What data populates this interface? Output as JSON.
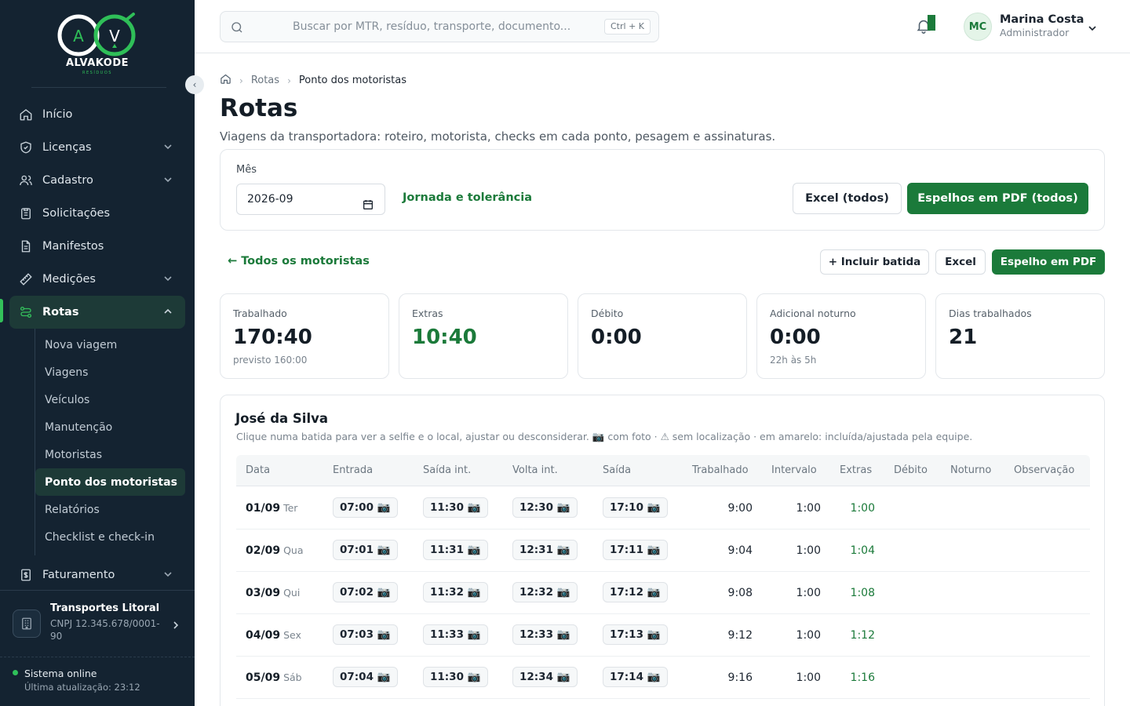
{
  "sidebar": {
    "brand": "ALVAKODE",
    "brand_sub": "RESÍDUOS",
    "collapse_icon": "‹",
    "nav": [
      {
        "label": "Início",
        "icon": "home-icon",
        "chevron": false
      },
      {
        "label": "Licenças",
        "icon": "shield-icon",
        "chevron": true
      },
      {
        "label": "Cadastro",
        "icon": "users-icon",
        "chevron": true
      },
      {
        "label": "Solicitações",
        "icon": "clipboard-icon",
        "chevron": false
      },
      {
        "label": "Manifestos",
        "icon": "document-icon",
        "chevron": false
      },
      {
        "label": "Medições",
        "icon": "ruler-icon",
        "chevron": true
      },
      {
        "label": "Rotas",
        "icon": "route-icon",
        "chevron": true,
        "active": true
      },
      {
        "label": "Faturamento",
        "icon": "invoice-icon",
        "chevron": true
      }
    ],
    "sub_nav": [
      "Nova viagem",
      "Viagens",
      "Veículos",
      "Manutenção",
      "Motoristas",
      "Ponto dos motoristas",
      "Relatórios",
      "Checklist e check-in"
    ],
    "company": {
      "name": "Transportes Litoral",
      "cnpj": "CNPJ 12.345.678/0001-90"
    },
    "status": {
      "title": "Sistema online",
      "updated": "Última atualização: 23:12"
    }
  },
  "topbar": {
    "search_placeholder": "Buscar por MTR, resíduo, transporte, documento...",
    "shortcut": "Ctrl + K",
    "user": {
      "initials": "MC",
      "name": "Marina Costa",
      "role": "Administrador"
    }
  },
  "breadcrumb": {
    "section": "Rotas",
    "current": "Ponto dos motoristas"
  },
  "page": {
    "title": "Rotas",
    "subtitle": "Viagens da transportadora: roteiro, motorista, checks em cada ponto, pesagem e assinaturas."
  },
  "filter": {
    "month_label": "Mês",
    "month_value": "2026-09",
    "jornada_link": "Jornada e tolerância",
    "excel_all": "Excel (todos)",
    "pdf_all": "Espelhos em PDF (todos)"
  },
  "actions": {
    "back": "← Todos os motoristas",
    "add_punch": "+ Incluir batida",
    "excel": "Excel",
    "pdf": "Espelho em PDF"
  },
  "stats": [
    {
      "label": "Trabalhado",
      "value": "170:40",
      "sub": "previsto 160:00",
      "accent": false
    },
    {
      "label": "Extras",
      "value": "10:40",
      "sub": "",
      "accent": true
    },
    {
      "label": "Débito",
      "value": "0:00",
      "sub": "",
      "accent": false
    },
    {
      "label": "Adicional noturno",
      "value": "0:00",
      "sub": "22h às 5h",
      "accent": false
    },
    {
      "label": "Dias trabalhados",
      "value": "21",
      "sub": "",
      "accent": false
    }
  ],
  "employee": {
    "name": "José da Silva",
    "hint": "Clique numa batida para ver a selfie e o local, ajustar ou desconsiderar. 📷 com foto · ⚠ sem localização · em amarelo: incluída/ajustada pela equipe."
  },
  "table": {
    "columns": [
      "Data",
      "Entrada",
      "Saída int.",
      "Volta int.",
      "Saída",
      "Trabalhado",
      "Intervalo",
      "Extras",
      "Débito",
      "Noturno",
      "Observação"
    ],
    "photo_icon": "📷",
    "rows": [
      {
        "date": "01/09",
        "day": "Ter",
        "in": "07:00",
        "out_int": "11:30",
        "back_int": "12:30",
        "out": "17:10",
        "worked": "9:00",
        "interval": "1:00",
        "extras": "1:00",
        "debit": "",
        "night": "",
        "note": ""
      },
      {
        "date": "02/09",
        "day": "Qua",
        "in": "07:01",
        "out_int": "11:31",
        "back_int": "12:31",
        "out": "17:11",
        "worked": "9:04",
        "interval": "1:00",
        "extras": "1:04",
        "debit": "",
        "night": "",
        "note": ""
      },
      {
        "date": "03/09",
        "day": "Qui",
        "in": "07:02",
        "out_int": "11:32",
        "back_int": "12:32",
        "out": "17:12",
        "worked": "9:08",
        "interval": "1:00",
        "extras": "1:08",
        "debit": "",
        "night": "",
        "note": ""
      },
      {
        "date": "04/09",
        "day": "Sex",
        "in": "07:03",
        "out_int": "11:33",
        "back_int": "12:33",
        "out": "17:13",
        "worked": "9:12",
        "interval": "1:00",
        "extras": "1:12",
        "debit": "",
        "night": "",
        "note": ""
      },
      {
        "date": "05/09",
        "day": "Sáb",
        "in": "07:04",
        "out_int": "11:30",
        "back_int": "12:34",
        "out": "17:14",
        "worked": "9:16",
        "interval": "1:00",
        "extras": "1:16",
        "debit": "",
        "night": "",
        "note": ""
      }
    ]
  },
  "colors": {
    "brand_green": "#1b7a3a",
    "sidebar_bg": "#142331",
    "online": "#2fc15a"
  }
}
